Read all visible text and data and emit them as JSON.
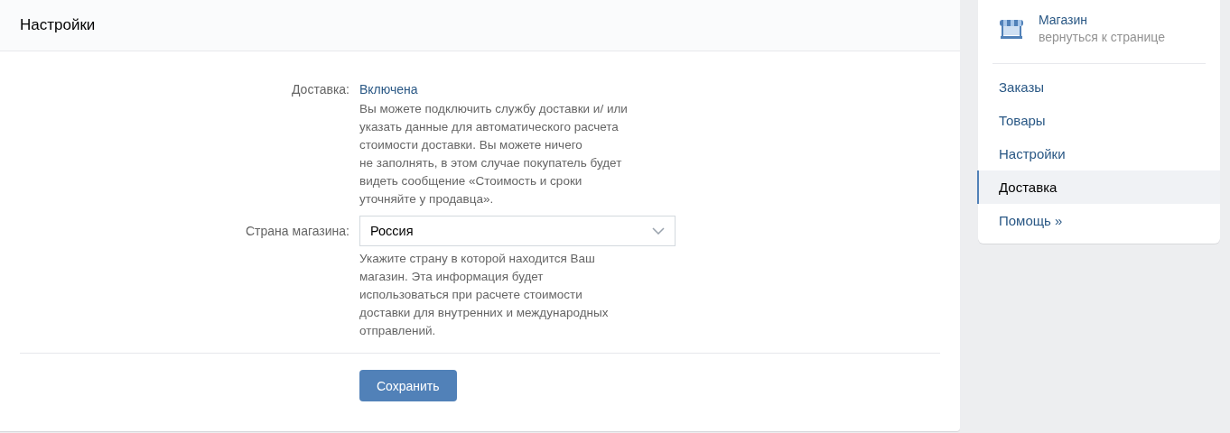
{
  "header": {
    "title": "Настройки"
  },
  "fields": [
    {
      "kind": "link",
      "label": "Доставка:",
      "value": "Включена",
      "hint": "Вы можете подключить службу доставки и/ или\nуказать данные для автоматического расчета\nстоимости доставки. Вы можете ничего\nне заполнять, в этом случае покупатель будет\nвидеть сообщение «Стоимость и сроки\nуточняйте у продавца»."
    },
    {
      "kind": "select",
      "label": "Страна магазина:",
      "value": "Россия",
      "hint": "Укажите страну в которой находится Ваш\nмагазин. Эта информация будет\nиспользоваться при расчете стоимости\nдоставки для внутренних и международных\nотправлений."
    }
  ],
  "save_button": "Сохранить",
  "sidebar": {
    "title": "Магазин",
    "subtitle": "вернуться к странице",
    "items": [
      {
        "label": "Заказы",
        "selected": false
      },
      {
        "label": "Товары",
        "selected": false
      },
      {
        "label": "Настройки",
        "selected": false
      },
      {
        "label": "Доставка",
        "selected": true
      },
      {
        "label": "Помощь »",
        "selected": false
      }
    ]
  }
}
